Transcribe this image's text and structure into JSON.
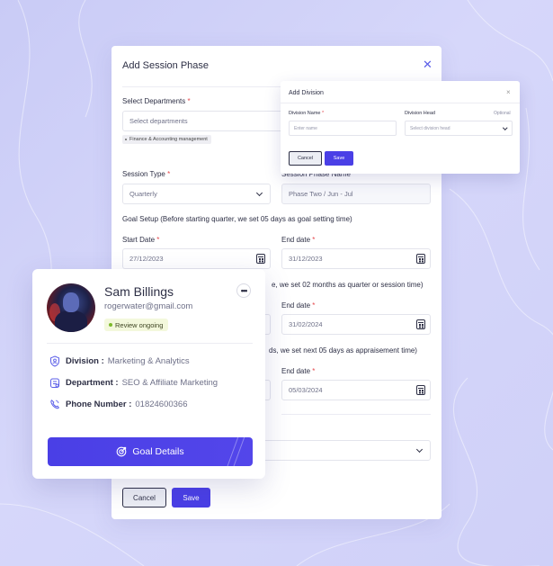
{
  "session_modal": {
    "title": "Add Session Phase",
    "select_departments": {
      "label": "Select Departments",
      "placeholder": "Select departments",
      "tag": "Finance & Accounting management"
    },
    "session_type": {
      "label": "Session Type",
      "value": "Quarterly"
    },
    "session_phase_name": {
      "label": "Session Phase Name",
      "value": "Phase Two / Jun - Jul"
    },
    "goal_setup_text": "Goal Setup (Before starting quarter, we set 05 days as goal setting time)",
    "goal_setup": {
      "start_label": "Start Date",
      "start_value": "27/12/2023",
      "end_label": "End date",
      "end_value": "31/12/2023"
    },
    "session_text_tail": "e, we set 02 months as quarter or session time)",
    "session_period": {
      "end_label": "End date",
      "end_value": "31/02/2024"
    },
    "appraisal_text_tail": "ds, we set next 05 days as appraisement time)",
    "appraisal_period": {
      "end_label": "End date",
      "end_value": "05/03/2024"
    },
    "cancel_label": "Cancel",
    "save_label": "Save"
  },
  "division_modal": {
    "title": "Add Division",
    "close_icon": "×",
    "division_name_label": "Division Name",
    "division_name_placeholder": "Enter name",
    "division_head_label": "Division Head",
    "division_head_optional": "Optional",
    "division_head_placeholder": "Select division head",
    "cancel_label": "Cancel",
    "save_label": "Save"
  },
  "profile_card": {
    "name": "Sam Billings",
    "email": "rogerwater@gmail.com",
    "status": "Review ongoing",
    "division_label": "Division :",
    "division_value": "Marketing & Analytics",
    "department_label": "Department :",
    "department_value": "SEO & Affiliate Marketing",
    "phone_label": "Phone Number :",
    "phone_value": "01824600366",
    "goal_button": "Goal Details"
  },
  "colors": {
    "accent": "#4a3fe6",
    "required": "#e5484d",
    "status_dot": "#7dba2b",
    "background": "#cfd0f8"
  },
  "icons": {
    "close": "close-icon",
    "calendar": "calendar-icon",
    "chevron": "chevron-down-icon",
    "more": "more-icon",
    "division": "shield-icon",
    "department": "building-icon",
    "phone": "phone-icon",
    "goal": "target-icon"
  }
}
